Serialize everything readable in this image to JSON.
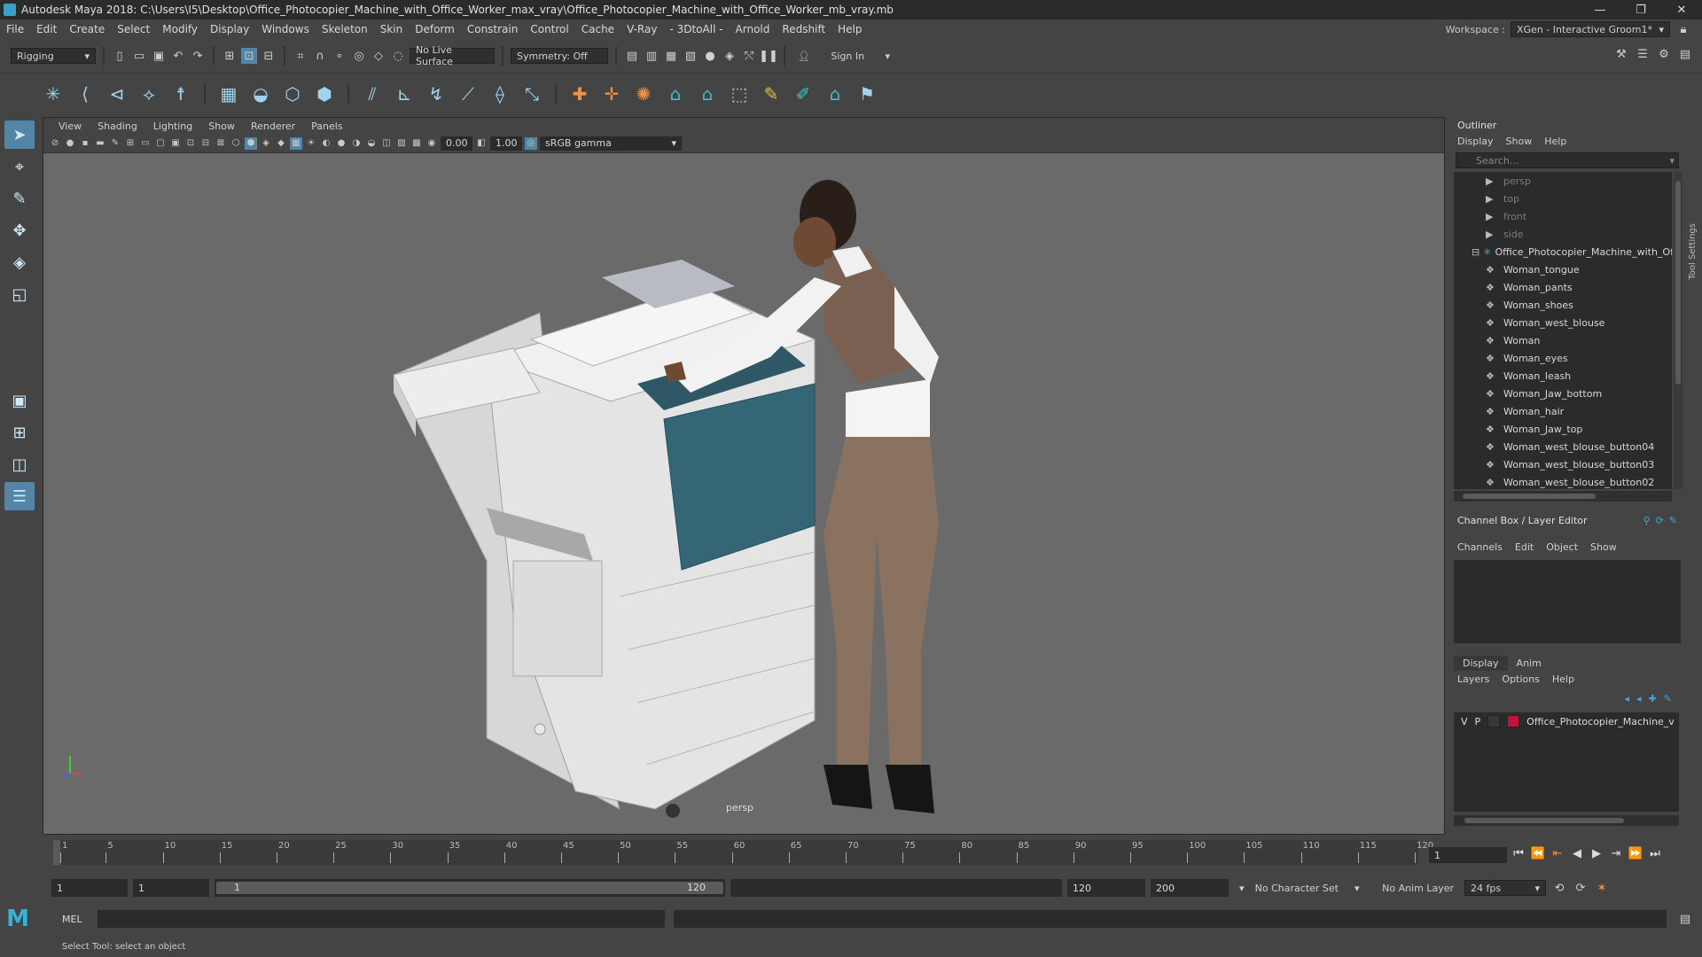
{
  "window": {
    "title": "Autodesk Maya 2018: C:\\Users\\I5\\Desktop\\Office_Photocopier_Machine_with_Office_Worker_max_vray\\Office_Photocopier_Machine_with_Office_Worker_mb_vray.mb",
    "minimize": "—",
    "restore": "❐",
    "close": "✕"
  },
  "menubar": {
    "items": [
      "File",
      "Edit",
      "Create",
      "Select",
      "Modify",
      "Display",
      "Windows",
      "Skeleton",
      "Skin",
      "Deform",
      "Constrain",
      "Control",
      "Cache",
      "V-Ray",
      "- 3DtoAll -",
      "Arnold",
      "Redshift",
      "Help"
    ],
    "workspace_label": "Workspace :",
    "workspace_value": "XGen - Interactive Groom1*"
  },
  "statusline": {
    "mode": "Rigging",
    "live_surface": "No Live Surface",
    "symmetry": "Symmetry: Off",
    "sign_in": "Sign In"
  },
  "viewport": {
    "menu": [
      "View",
      "Shading",
      "Lighting",
      "Show",
      "Renderer",
      "Panels"
    ],
    "exposure": "0.00",
    "gamma": "1.00",
    "color_space": "sRGB gamma",
    "camera": "persp"
  },
  "outliner": {
    "title": "Outliner",
    "menu": [
      "Display",
      "Show",
      "Help"
    ],
    "search_placeholder": "Search...",
    "cameras": [
      "persp",
      "top",
      "front",
      "side"
    ],
    "group": "Office_Photocopier_Machine_with_Of",
    "items": [
      "Woman_tongue",
      "Woman_pants",
      "Woman_shoes",
      "Woman_west_blouse",
      "Woman",
      "Woman_eyes",
      "Woman_leash",
      "Woman_Jaw_bottom",
      "Woman_hair",
      "Woman_Jaw_top",
      "Woman_west_blouse_button04",
      "Woman_west_blouse_button03",
      "Woman_west_blouse_button02"
    ]
  },
  "channelbox": {
    "title": "Channel Box / Layer Editor",
    "menu": [
      "Channels",
      "Edit",
      "Object",
      "Show"
    ],
    "layer_tabs": [
      "Display",
      "Anim"
    ],
    "layer_menu": [
      "Layers",
      "Options",
      "Help"
    ],
    "layer": {
      "v": "V",
      "p": "P",
      "name": "Office_Photocopier_Machine_v",
      "color": "#c0143c"
    },
    "side_tab": "Tool Settings"
  },
  "timeline": {
    "ticks": [
      1,
      5,
      10,
      15,
      20,
      25,
      30,
      35,
      40,
      45,
      50,
      55,
      60,
      65,
      70,
      75,
      80,
      85,
      90,
      95,
      100,
      105,
      110,
      115,
      120
    ],
    "current_frame": "1",
    "range_start": "1",
    "playback_start": "1",
    "slider_start": "1",
    "slider_end": "120",
    "playback_end": "120",
    "range_end": "200",
    "character_set": "No Character Set",
    "anim_layer": "No Anim Layer",
    "fps": "24 fps"
  },
  "cmdline": {
    "label": "MEL",
    "help": "Select Tool: select an object"
  }
}
